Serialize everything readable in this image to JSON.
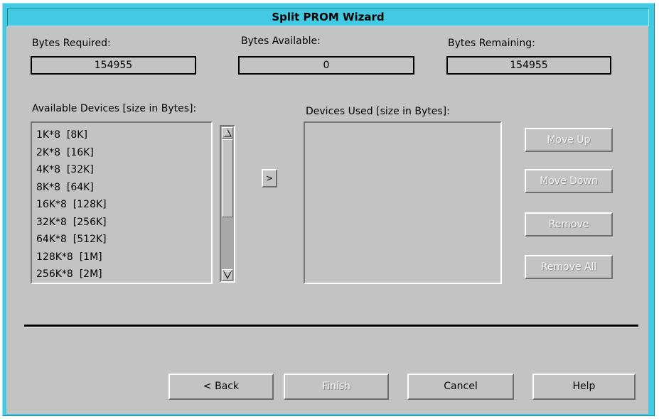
{
  "window": {
    "title": "Split PROM Wizard"
  },
  "bytes": {
    "required_label": "Bytes Required:",
    "required_value": "154955",
    "available_label": "Bytes Available:",
    "available_value": "0",
    "remaining_label": "Bytes Remaining:",
    "remaining_value": "154955"
  },
  "available_devices": {
    "label": "Available Devices [size in Bytes]:",
    "items": [
      "1K*8  [8K]",
      "2K*8  [16K]",
      "4K*8  [32K]",
      "8K*8  [64K]",
      "16K*8  [128K]",
      "32K*8  [256K]",
      "64K*8  [512K]",
      "128K*8  [1M]",
      "256K*8  [2M]"
    ]
  },
  "add_button": {
    "label": ">"
  },
  "devices_used": {
    "label": "Devices Used [size in Bytes]:",
    "items": []
  },
  "side_buttons": {
    "move_up": "Move Up",
    "move_down": "Move Down",
    "remove": "Remove",
    "remove_all": "Remove All"
  },
  "footer_buttons": {
    "back": "< Back",
    "finish": "Finish",
    "cancel": "Cancel",
    "help": "Help"
  },
  "icons": {
    "scroll_up": "triangle-up-outline",
    "scroll_down": "triangle-down-outline"
  }
}
